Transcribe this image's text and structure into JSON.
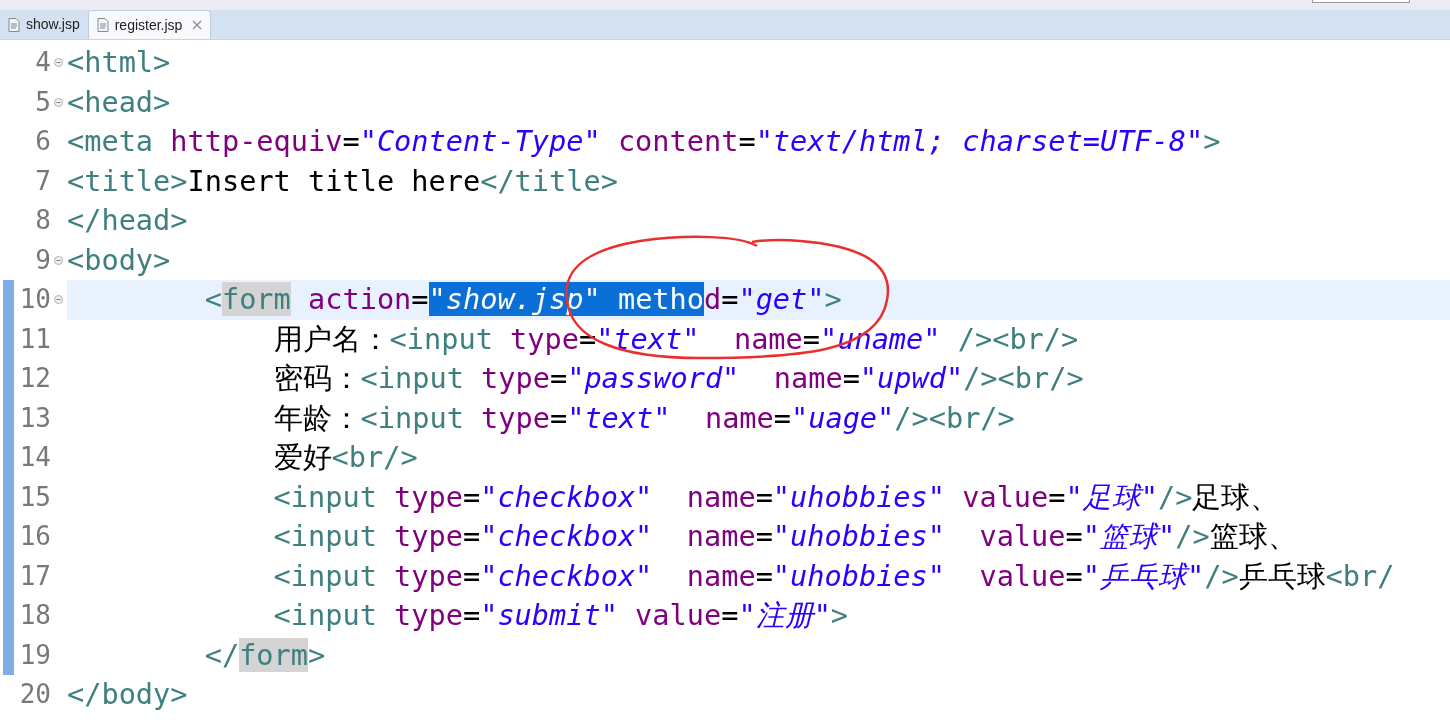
{
  "tabs": [
    {
      "label": "show.jsp",
      "selected": false,
      "closable": false
    },
    {
      "label": "register.jsp",
      "selected": true,
      "closable": true
    }
  ],
  "annotation": {
    "kind": "circle"
  },
  "lines": [
    {
      "number": "4",
      "fold": true,
      "changed": false,
      "current": false,
      "tokens": [
        {
          "kind": "tag",
          "text": "<html>"
        }
      ]
    },
    {
      "number": "5",
      "fold": true,
      "changed": false,
      "current": false,
      "tokens": [
        {
          "kind": "tag",
          "text": "<head>"
        }
      ]
    },
    {
      "number": "6",
      "fold": false,
      "changed": false,
      "current": false,
      "tokens": [
        {
          "kind": "tag",
          "text": "<meta"
        },
        {
          "kind": "attr",
          "text": " http-equiv"
        },
        {
          "kind": "text",
          "text": "="
        },
        {
          "kind": "value",
          "text": "\"Content-Type\""
        },
        {
          "kind": "attr",
          "text": " content"
        },
        {
          "kind": "text",
          "text": "="
        },
        {
          "kind": "value",
          "text": "\"text/html; charset=UTF-8\""
        },
        {
          "kind": "tag",
          "text": ">"
        }
      ]
    },
    {
      "number": "7",
      "fold": false,
      "changed": false,
      "current": false,
      "tokens": [
        {
          "kind": "tag",
          "text": "<title>"
        },
        {
          "kind": "text",
          "text": "Insert title here"
        },
        {
          "kind": "tag",
          "text": "</title>"
        }
      ]
    },
    {
      "number": "8",
      "fold": false,
      "changed": false,
      "current": false,
      "tokens": [
        {
          "kind": "tag",
          "text": "</head>"
        }
      ]
    },
    {
      "number": "9",
      "fold": true,
      "changed": false,
      "current": false,
      "tokens": [
        {
          "kind": "tag",
          "text": "<body>"
        }
      ]
    },
    {
      "number": "10",
      "fold": true,
      "changed": true,
      "current": true,
      "tokens": [
        {
          "kind": "tag",
          "text": "        <"
        },
        {
          "kind": "tag",
          "text": "form",
          "bracket_match": true
        },
        {
          "kind": "attr",
          "text": " action"
        },
        {
          "kind": "text",
          "text": "="
        },
        {
          "kind": "value",
          "text": "\"show.jsp\"",
          "selected": true
        },
        {
          "kind": "attr",
          "text": " metho",
          "selected": true
        },
        {
          "kind": "attr",
          "text": "d"
        },
        {
          "kind": "text",
          "text": "="
        },
        {
          "kind": "value",
          "text": "\"get\""
        },
        {
          "kind": "tag",
          "text": ">"
        }
      ]
    },
    {
      "number": "11",
      "fold": false,
      "changed": true,
      "current": false,
      "tokens": [
        {
          "kind": "text",
          "text": "            用户名："
        },
        {
          "kind": "tag",
          "text": "<input"
        },
        {
          "kind": "attr",
          "text": " type"
        },
        {
          "kind": "text",
          "text": "="
        },
        {
          "kind": "value",
          "text": "\"text\""
        },
        {
          "kind": "attr",
          "text": "  name"
        },
        {
          "kind": "text",
          "text": "="
        },
        {
          "kind": "value",
          "text": "\"uname\""
        },
        {
          "kind": "tag",
          "text": " /><br/>"
        }
      ]
    },
    {
      "number": "12",
      "fold": false,
      "changed": true,
      "current": false,
      "tokens": [
        {
          "kind": "text",
          "text": "            密码："
        },
        {
          "kind": "tag",
          "text": "<input"
        },
        {
          "kind": "attr",
          "text": " type"
        },
        {
          "kind": "text",
          "text": "="
        },
        {
          "kind": "value",
          "text": "\"password\""
        },
        {
          "kind": "attr",
          "text": "  name"
        },
        {
          "kind": "text",
          "text": "="
        },
        {
          "kind": "value",
          "text": "\"upwd\""
        },
        {
          "kind": "tag",
          "text": "/><br/>"
        }
      ]
    },
    {
      "number": "13",
      "fold": false,
      "changed": true,
      "current": false,
      "tokens": [
        {
          "kind": "text",
          "text": "            年龄："
        },
        {
          "kind": "tag",
          "text": "<input"
        },
        {
          "kind": "attr",
          "text": " type"
        },
        {
          "kind": "text",
          "text": "="
        },
        {
          "kind": "value",
          "text": "\"text\""
        },
        {
          "kind": "attr",
          "text": "  name"
        },
        {
          "kind": "text",
          "text": "="
        },
        {
          "kind": "value",
          "text": "\"uage\""
        },
        {
          "kind": "tag",
          "text": "/><br/>"
        }
      ]
    },
    {
      "number": "14",
      "fold": false,
      "changed": true,
      "current": false,
      "tokens": [
        {
          "kind": "text",
          "text": "            爱好"
        },
        {
          "kind": "tag",
          "text": "<br/>"
        }
      ]
    },
    {
      "number": "15",
      "fold": false,
      "changed": true,
      "current": false,
      "tokens": [
        {
          "kind": "tag",
          "text": "            <input"
        },
        {
          "kind": "attr",
          "text": " type"
        },
        {
          "kind": "text",
          "text": "="
        },
        {
          "kind": "value",
          "text": "\"checkbox\""
        },
        {
          "kind": "attr",
          "text": "  name"
        },
        {
          "kind": "text",
          "text": "="
        },
        {
          "kind": "value",
          "text": "\"uhobbies\""
        },
        {
          "kind": "attr",
          "text": " value"
        },
        {
          "kind": "text",
          "text": "="
        },
        {
          "kind": "value",
          "text": "\"足球\""
        },
        {
          "kind": "tag",
          "text": "/>"
        },
        {
          "kind": "text",
          "text": "足球、"
        }
      ]
    },
    {
      "number": "16",
      "fold": false,
      "changed": true,
      "current": false,
      "tokens": [
        {
          "kind": "tag",
          "text": "            <input"
        },
        {
          "kind": "attr",
          "text": " type"
        },
        {
          "kind": "text",
          "text": "="
        },
        {
          "kind": "value",
          "text": "\"checkbox\""
        },
        {
          "kind": "attr",
          "text": "  name"
        },
        {
          "kind": "text",
          "text": "="
        },
        {
          "kind": "value",
          "text": "\"uhobbies\""
        },
        {
          "kind": "attr",
          "text": "  value"
        },
        {
          "kind": "text",
          "text": "="
        },
        {
          "kind": "value",
          "text": "\"篮球\""
        },
        {
          "kind": "tag",
          "text": "/>"
        },
        {
          "kind": "text",
          "text": "篮球、"
        }
      ]
    },
    {
      "number": "17",
      "fold": false,
      "changed": true,
      "current": false,
      "tokens": [
        {
          "kind": "tag",
          "text": "            <input"
        },
        {
          "kind": "attr",
          "text": " type"
        },
        {
          "kind": "text",
          "text": "="
        },
        {
          "kind": "value",
          "text": "\"checkbox\""
        },
        {
          "kind": "attr",
          "text": "  name"
        },
        {
          "kind": "text",
          "text": "="
        },
        {
          "kind": "value",
          "text": "\"uhobbies\""
        },
        {
          "kind": "attr",
          "text": "  value"
        },
        {
          "kind": "text",
          "text": "="
        },
        {
          "kind": "value",
          "text": "\"乒乓球\""
        },
        {
          "kind": "tag",
          "text": "/>"
        },
        {
          "kind": "text",
          "text": "乒乓球"
        },
        {
          "kind": "tag",
          "text": "<br/"
        }
      ]
    },
    {
      "number": "18",
      "fold": false,
      "changed": true,
      "current": false,
      "tokens": [
        {
          "kind": "tag",
          "text": "            <input"
        },
        {
          "kind": "attr",
          "text": " type"
        },
        {
          "kind": "text",
          "text": "="
        },
        {
          "kind": "value",
          "text": "\"submit\""
        },
        {
          "kind": "attr",
          "text": " value"
        },
        {
          "kind": "text",
          "text": "="
        },
        {
          "kind": "value",
          "text": "\"注册\""
        },
        {
          "kind": "tag",
          "text": ">"
        }
      ]
    },
    {
      "number": "19",
      "fold": false,
      "changed": true,
      "current": false,
      "tokens": [
        {
          "kind": "tag",
          "text": "        </"
        },
        {
          "kind": "tag",
          "text": "form",
          "bracket_match": true
        },
        {
          "kind": "tag",
          "text": ">"
        }
      ]
    },
    {
      "number": "20",
      "fold": false,
      "changed": false,
      "current": false,
      "tokens": [
        {
          "kind": "tag",
          "text": "</body>"
        }
      ]
    }
  ]
}
